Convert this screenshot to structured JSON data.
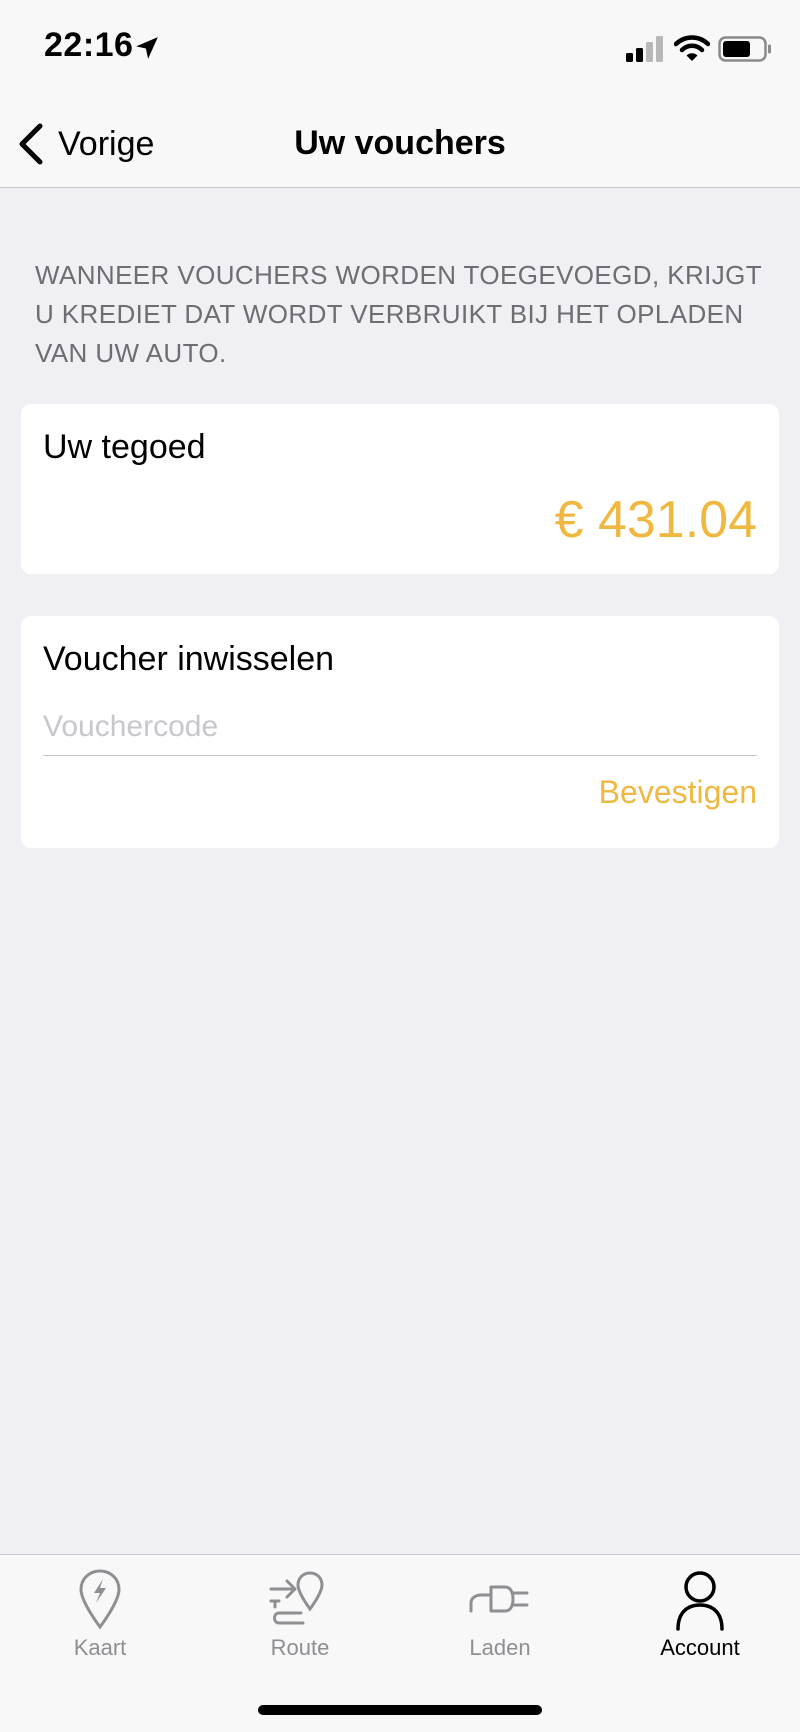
{
  "status_bar": {
    "time": "22:16"
  },
  "nav": {
    "back_label": "Vorige",
    "title": "Uw vouchers"
  },
  "info_text": "WANNEER VOUCHERS WORDEN TOEGEVOEGD, KRIJGT U KREDIET DAT WORDT VERBRUIKT BIJ HET OPLADEN VAN UW AUTO.",
  "balance": {
    "title": "Uw tegoed",
    "value": "€ 431.04"
  },
  "voucher": {
    "title": "Voucher inwisselen",
    "input_value": "",
    "placeholder": "Vouchercode",
    "confirm_label": "Bevestigen"
  },
  "tabs": [
    {
      "label": "Kaart",
      "icon": "map-pin-bolt-icon",
      "active": false
    },
    {
      "label": "Route",
      "icon": "route-icon",
      "active": false
    },
    {
      "label": "Laden",
      "icon": "plug-icon",
      "active": false
    },
    {
      "label": "Account",
      "icon": "person-icon",
      "active": true
    }
  ],
  "colors": {
    "accent": "#f0b840",
    "background": "#efeff4",
    "secondary_text": "#6d6d72",
    "inactive_tab": "#8e8e93"
  }
}
